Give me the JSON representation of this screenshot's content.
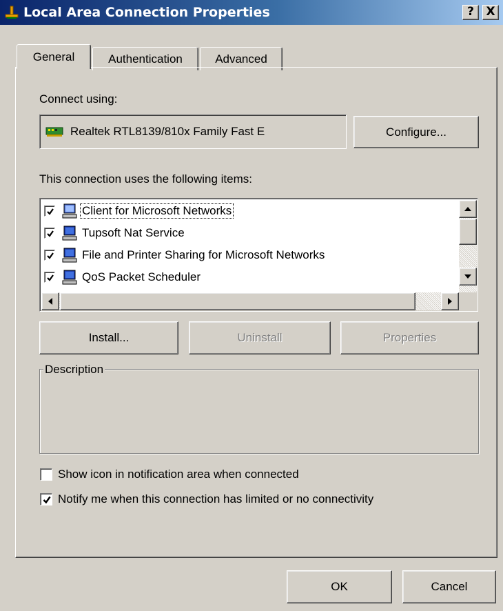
{
  "window": {
    "title": "Local Area Connection Properties",
    "help_glyph": "?",
    "close_glyph": "X"
  },
  "tabs": [
    {
      "label": "General",
      "active": true
    },
    {
      "label": "Authentication",
      "active": false
    },
    {
      "label": "Advanced",
      "active": false
    }
  ],
  "general": {
    "connect_using_label": "Connect using:",
    "adapter_name": "Realtek RTL8139/810x Family Fast E",
    "configure_button": "Configure...",
    "items_label": "This connection uses the following items:",
    "items": [
      {
        "label": "Client for Microsoft Networks",
        "checked": true,
        "selected": true
      },
      {
        "label": "Tupsoft Nat Service",
        "checked": true,
        "selected": false
      },
      {
        "label": "File and Printer Sharing for Microsoft Networks",
        "checked": true,
        "selected": false
      },
      {
        "label": "QoS Packet Scheduler",
        "checked": true,
        "selected": false
      }
    ],
    "install_button": "Install...",
    "uninstall_button": "Uninstall",
    "properties_button": "Properties",
    "description_label": "Description",
    "description_text": "",
    "show_icon_option": {
      "label": "Show icon in notification area when connected",
      "checked": false
    },
    "notify_option": {
      "label": "Notify me when this connection has limited or no connectivity",
      "checked": true
    }
  },
  "footer": {
    "ok_button": "OK",
    "cancel_button": "Cancel"
  }
}
